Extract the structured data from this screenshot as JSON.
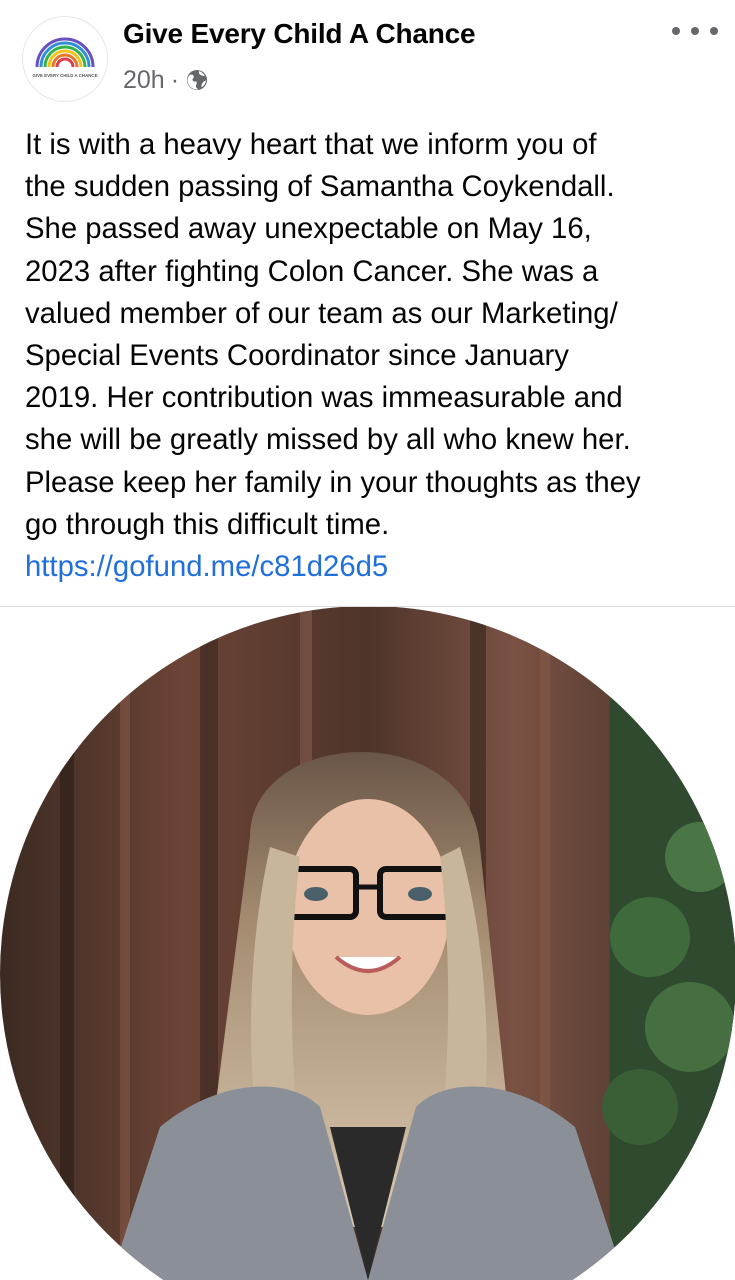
{
  "post": {
    "page_name": "Give Every Child A Chance",
    "avatar_logo_text": "GIVE EVERY CHILD A CHANCE",
    "time": "20h",
    "separator": "·",
    "privacy_icon": "globe-icon",
    "more_icon": "more-dots-icon",
    "text_lines": [
      "It is with a heavy heart that we inform you of",
      "the sudden passing of Samantha Coykendall.",
      "She passed away unexpectable on May 16,",
      "2023 after fighting Colon Cancer. She was a",
      "valued member of our team as our Marketing/",
      "Special Events Coordinator since January",
      "2019. Her contribution was immeasurable and",
      "she will be greatly missed by all who knew her.",
      "Please keep her family in your thoughts as they",
      "go through this difficult time."
    ],
    "link": "https://gofund.me/c81d26d5"
  },
  "colors": {
    "link": "#216fdb",
    "secondary_text": "#65676b",
    "divider": "#dadde1"
  }
}
